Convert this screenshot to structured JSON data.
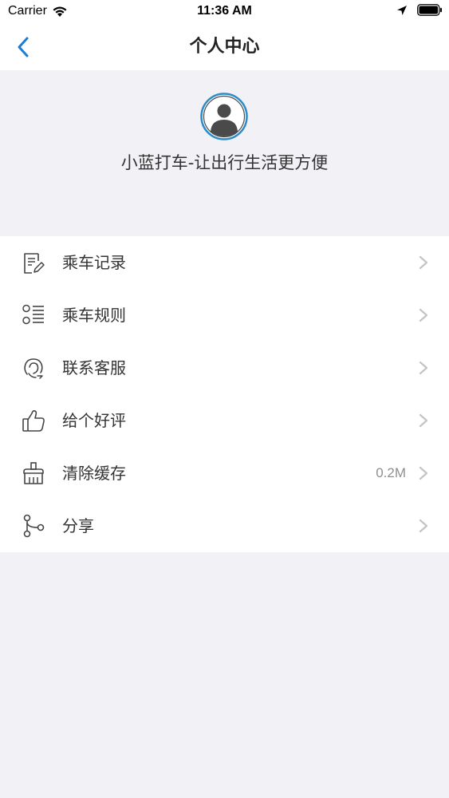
{
  "status_bar": {
    "carrier": "Carrier",
    "time": "11:36 AM"
  },
  "nav": {
    "title": "个人中心"
  },
  "profile": {
    "slogan": "小蓝打车-让出行生活更方便"
  },
  "menu": {
    "items": [
      {
        "label": "乘车记录",
        "icon": "ride-record-icon"
      },
      {
        "label": "乘车规则",
        "icon": "list-icon"
      },
      {
        "label": "联系客服",
        "icon": "customer-service-icon"
      },
      {
        "label": "给个好评",
        "icon": "thumbs-up-icon"
      },
      {
        "label": "清除缓存",
        "icon": "broom-icon",
        "value": "0.2M"
      },
      {
        "label": "分享",
        "icon": "share-icon"
      }
    ]
  },
  "colors": {
    "accent": "#1a7ed6",
    "background": "#f2f2f6",
    "chevron": "#c4c4c8"
  }
}
